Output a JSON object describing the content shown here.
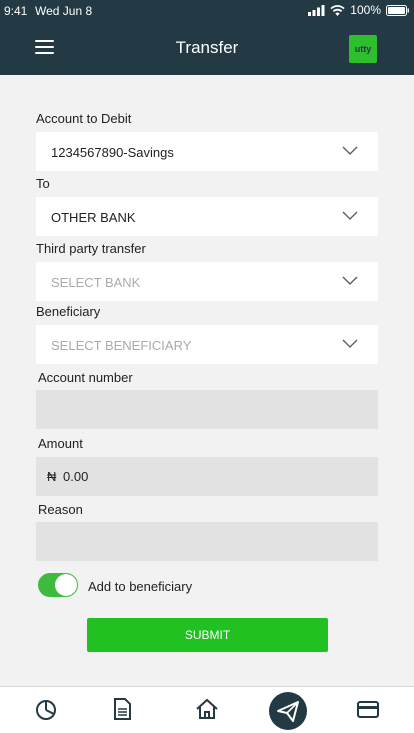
{
  "status": {
    "time": "9:41",
    "date": "Wed Jun 8",
    "battery": "100%"
  },
  "header": {
    "title": "Transfer",
    "logo_text": "utty"
  },
  "form": {
    "debit_label": "Account to Debit",
    "debit_value": "1234567890-Savings",
    "to_label": "To",
    "to_value": "OTHER BANK",
    "third_party_label": "Third party transfer",
    "bank_placeholder": "SELECT BANK",
    "beneficiary_label": "Beneficiary",
    "beneficiary_placeholder": "SELECT BENEFICIARY",
    "account_label": "Account number",
    "amount_label": "Amount",
    "currency_symbol": "₦",
    "amount_value": "0.00",
    "reason_label": "Reason",
    "add_beneficiary_label": "Add to beneficiary",
    "add_beneficiary_on": true,
    "submit_label": "SUBMIT"
  },
  "tabs": [
    {
      "icon": "pie-chart-icon"
    },
    {
      "icon": "document-icon"
    },
    {
      "icon": "home-icon"
    },
    {
      "icon": "send-icon",
      "active": true
    },
    {
      "icon": "card-icon"
    }
  ],
  "colors": {
    "header": "#233a44",
    "accent": "#21c121",
    "field": "#e2e2e2"
  }
}
